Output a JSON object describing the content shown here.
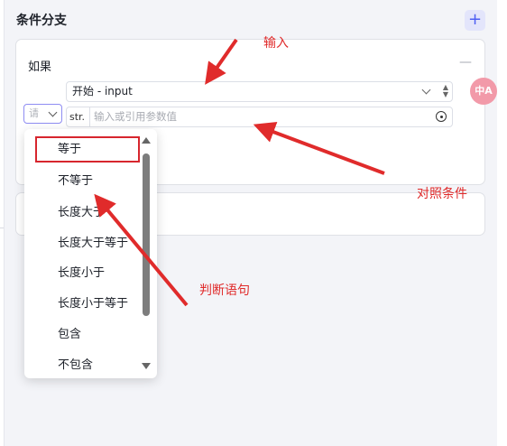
{
  "panel": {
    "title": "条件分支",
    "add_icon": "plus-icon",
    "add_label": "+"
  },
  "if_block": {
    "label": "如果",
    "collapse_label": "—",
    "operator_placeholder": "请",
    "variable_value": "开始 - input",
    "value_type": "str.",
    "value_placeholder": "输入或引用参数值"
  },
  "dropdown": {
    "items": [
      "等于",
      "不等于",
      "长度大于",
      "长度大于等于",
      "长度小于",
      "长度小于等于",
      "包含",
      "不包含"
    ],
    "highlighted_index": 0
  },
  "annotations": {
    "input": "输入",
    "compare": "对照条件",
    "judge": "判断语句"
  },
  "translate_button": {
    "icon": "translate-icon",
    "label": "中A"
  },
  "colors": {
    "accent": "#4e5ef3",
    "annotation": "#e02b2b"
  }
}
